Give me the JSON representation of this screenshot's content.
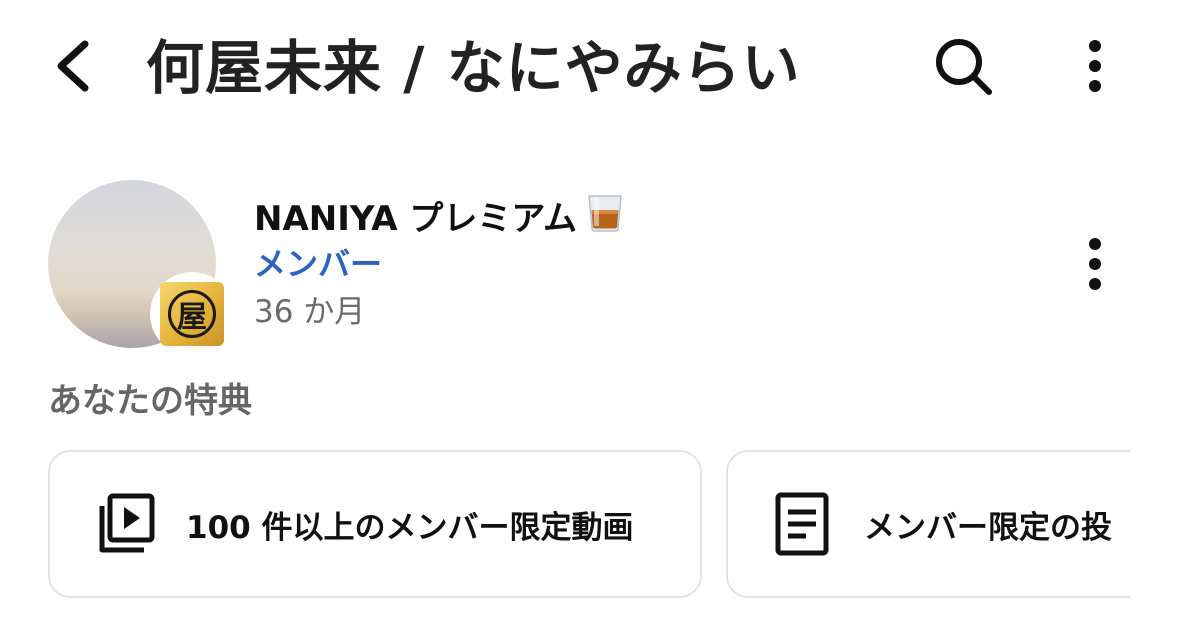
{
  "header": {
    "title": "何屋未来 / なにやみらい",
    "back_icon": "back-arrow-icon",
    "search_icon": "search-icon",
    "more_icon": "more-vert-icon"
  },
  "membership": {
    "tier_name": "NANIYA プレミアム",
    "tier_emoji": "whisky-glass-icon",
    "status": "メンバー",
    "duration": "36 か月",
    "badge_char": "屋",
    "status_color": "#2b63c4"
  },
  "perks": {
    "heading": "あなたの特典",
    "items": [
      {
        "label": "100 件以上のメンバー限定動画",
        "icon": "video-library-icon"
      },
      {
        "label": "メンバー限定の投",
        "icon": "document-post-icon"
      }
    ]
  }
}
